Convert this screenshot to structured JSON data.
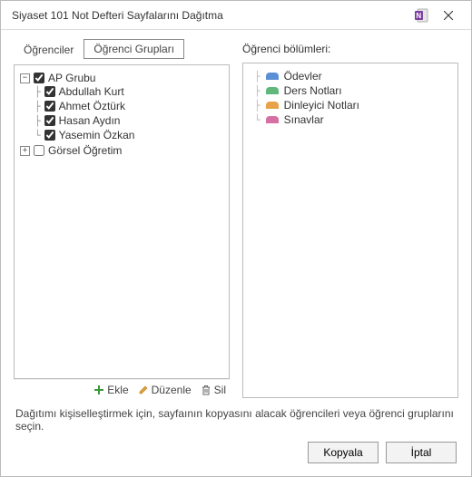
{
  "window": {
    "title": "Siyaset 101 Not Defteri Sayfalarını Dağıtma"
  },
  "tabs": {
    "students": "Öğrenciler",
    "groups": "Öğrenci Grupları"
  },
  "sections_header": "Öğrenci bölümleri:",
  "tree": {
    "group1": {
      "label": "AP Grubu",
      "children": {
        "s1": "Abdullah Kurt",
        "s2": "Ahmet Öztürk",
        "s3": "Hasan Aydın",
        "s4": "Yasemin Özkan"
      }
    },
    "group2": {
      "label": "Görsel Öğretim"
    }
  },
  "toolbar": {
    "add": "Ekle",
    "edit": "Düzenle",
    "delete": "Sil"
  },
  "sections": {
    "s1": {
      "label": "Ödevler",
      "color": "#5a8fd6"
    },
    "s2": {
      "label": "Ders Notları",
      "color": "#5fb77a"
    },
    "s3": {
      "label": "Dinleyici Notları",
      "color": "#e7a24a"
    },
    "s4": {
      "label": "Sınavlar",
      "color": "#d66fa3"
    }
  },
  "hint": "Dağıtımı kişiselleştirmek için, sayfaının kopyasını alacak öğrencileri veya öğrenci gruplarını seçin.",
  "buttons": {
    "copy": "Kopyala",
    "cancel": "İptal"
  }
}
